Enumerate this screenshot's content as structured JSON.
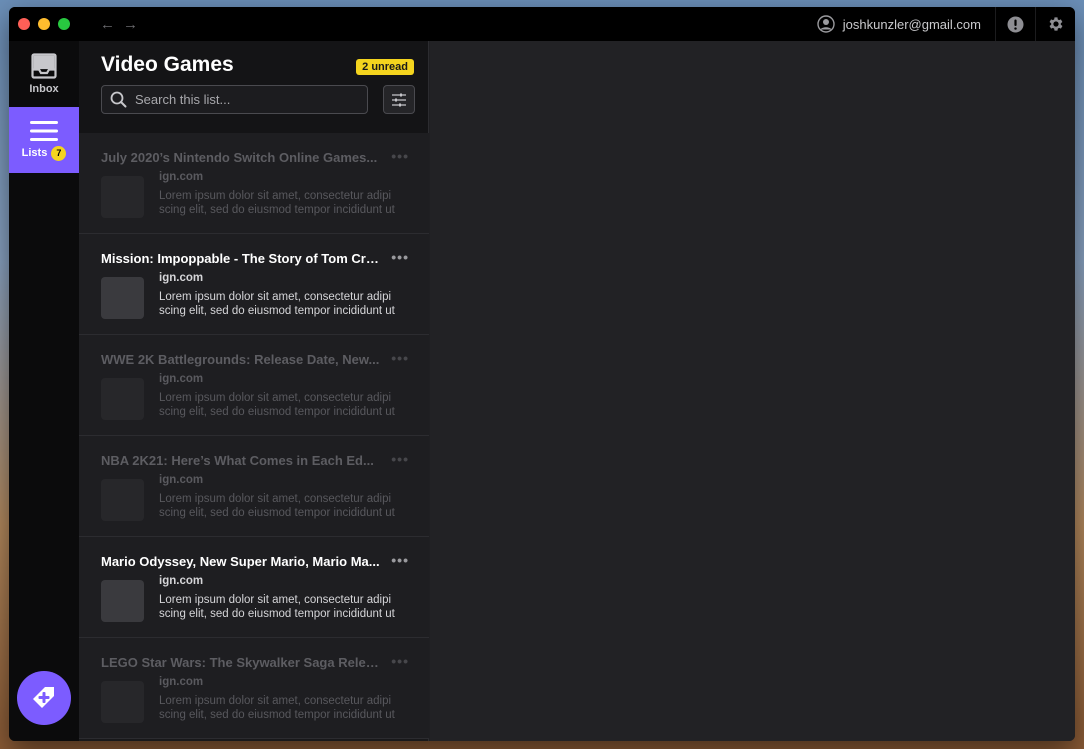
{
  "account": {
    "email": "joshkunzler@gmail.com"
  },
  "nav": {
    "back_icon": "arrow-left-icon",
    "forward_icon": "arrow-right-icon"
  },
  "sidebar": {
    "inbox_label": "Inbox",
    "lists_label": "Lists",
    "lists_count": "7"
  },
  "list": {
    "title": "Video Games",
    "unread_badge": "2 unread",
    "search_placeholder": "Search this list..."
  },
  "items": [
    {
      "title": "July 2020’s Nintendo Switch Online Games...",
      "source": "ign.com",
      "excerpt": "Lorem ipsum dolor sit amet, consectetur adipi scing elit, sed do eiusmod tempor incididunt ut",
      "state": "read"
    },
    {
      "title": "Mission: Impoppable - The Story of Tom Cru...",
      "source": "ign.com",
      "excerpt": "Lorem ipsum dolor sit amet, consectetur adipi scing elit, sed do eiusmod tempor incididunt ut",
      "state": "unread"
    },
    {
      "title": "WWE 2K Battlegrounds: Release Date, New...",
      "source": "ign.com",
      "excerpt": "Lorem ipsum dolor sit amet, consectetur adipi scing elit, sed do eiusmod tempor incididunt ut",
      "state": "read"
    },
    {
      "title": "NBA 2K21: Here’s What Comes in Each Ed...",
      "source": "ign.com",
      "excerpt": "Lorem ipsum dolor sit amet, consectetur adipi scing elit, sed do eiusmod tempor incididunt ut",
      "state": "read"
    },
    {
      "title": "Mario Odyssey, New Super Mario, Mario Ma...",
      "source": "ign.com",
      "excerpt": "Lorem ipsum dolor sit amet, consectetur adipi scing elit, sed do eiusmod tempor incididunt ut",
      "state": "unread"
    },
    {
      "title": "LEGO Star Wars: The Skywalker Saga Releas...",
      "source": "ign.com",
      "excerpt": "Lorem ipsum dolor sit amet, consectetur adipi scing elit, sed do eiusmod tempor incididunt ut",
      "state": "read"
    }
  ],
  "colors": {
    "accent": "#7c5cff",
    "badge": "#f4d41e"
  }
}
